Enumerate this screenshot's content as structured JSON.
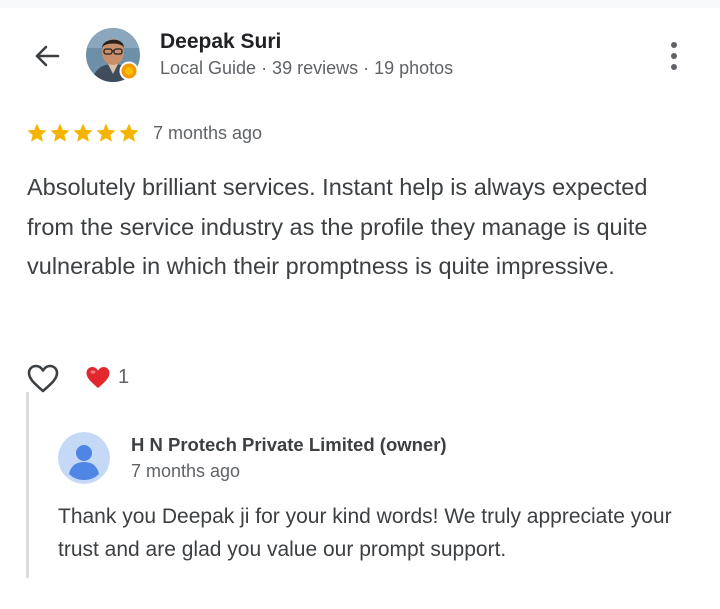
{
  "reviewer": {
    "name": "Deepak Suri",
    "subtitle": "Local Guide · 39 reviews · 19 photos"
  },
  "rating": {
    "stars": 5,
    "max_stars": 5,
    "time": "7 months ago"
  },
  "review": {
    "text": "Absolutely brilliant services. Instant help is always expected from the service industry as the profile they manage is quite vulnerable in which their promptness is quite impressive."
  },
  "reactions": {
    "heart_count": "1"
  },
  "owner_reply": {
    "name": "H N Protech Private Limited (owner)",
    "time": "7 months ago",
    "text": "Thank you Deepak ji for your kind words! We truly appreciate your trust and are glad you value our prompt support."
  },
  "icons": {
    "back": "arrow-back-icon",
    "more": "more-vertical-icon",
    "star": "star-icon",
    "like": "heart-outline-icon",
    "reaction": "red-heart-icon",
    "owner_avatar": "person-icon"
  },
  "colors": {
    "star": "#f5b400",
    "heart": "#e0282e",
    "text": "#3c4043",
    "secondary": "#5f6368",
    "owner_avatar_bg": "#c5d9f7",
    "owner_avatar_fg": "#4f86e6"
  }
}
